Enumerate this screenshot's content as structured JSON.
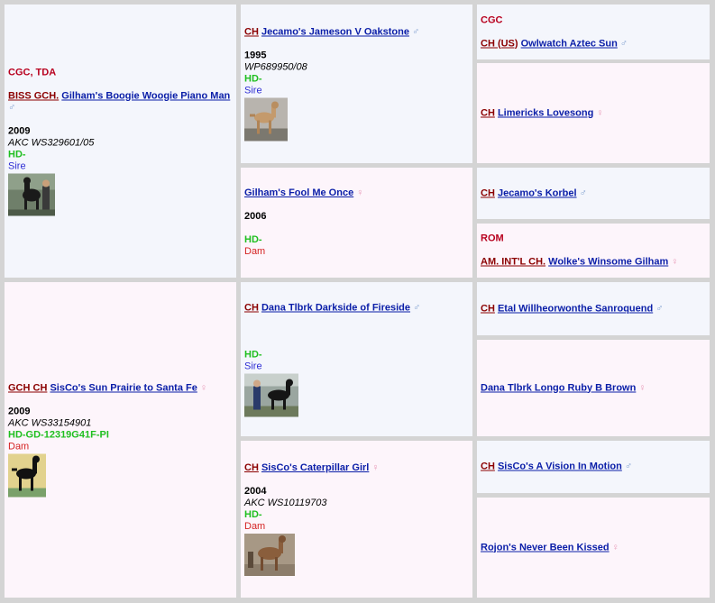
{
  "colors": {
    "border": "#d4d4d4",
    "male_bg": "#f4f6fc",
    "female_bg": "#fdf5fb",
    "titles": "#b8001e",
    "prefix": "#8b0000",
    "name_link": "#0a1ea8",
    "health": "#1fbf1f",
    "sire": "#2d2dd4",
    "dam": "#d42323"
  },
  "symbols": {
    "male": "♂",
    "female": "♀"
  },
  "dogs": [
    {
      "titles_before": "CGC, TDA",
      "prefix": "BISS GCH.",
      "name": "Gilham's Boogie Woogie Piano Man",
      "sex": "male",
      "icon": "male-symbol-icon",
      "year": "2009",
      "registration": "AKC WS329601/05",
      "health": "HD-",
      "role": "Sire",
      "photo": "sire-photo"
    },
    {
      "prefix": "CH",
      "name": "Jecamo's Jameson V Oakstone",
      "sex": "male",
      "icon": "male-symbol-icon",
      "year": "1995",
      "registration": "WP689950/08",
      "health": "HD-",
      "role": "Sire",
      "photo": "sire-photo"
    },
    {
      "titles_before": "CGC",
      "prefix": "CH (US)",
      "name": "Owlwatch Aztec Sun",
      "sex": "male",
      "icon": "male-symbol-icon"
    },
    {
      "prefix": "CH",
      "name": "Limericks Lovesong",
      "sex": "female",
      "icon": "female-symbol-icon"
    },
    {
      "name": "Gilham's Fool Me Once",
      "sex": "female",
      "icon": "female-symbol-icon",
      "year": "2006",
      "health": "HD-",
      "role": "Dam"
    },
    {
      "prefix": "CH",
      "name": "Jecamo's Korbel",
      "sex": "male",
      "icon": "male-symbol-icon"
    },
    {
      "titles_before": "ROM",
      "prefix": "AM. INT'L CH.",
      "name": "Wolke's Winsome Gilham",
      "sex": "female",
      "icon": "female-symbol-icon"
    },
    {
      "prefix": "GCH CH",
      "name": "SisCo's Sun Prairie to Santa Fe",
      "sex": "female",
      "icon": "female-symbol-icon",
      "year": "2009",
      "registration": "AKC WS33154901",
      "health": "HD-GD-12319G41F-PI",
      "role": "Dam",
      "photo": "dam-photo"
    },
    {
      "prefix": "CH",
      "name": "Dana Tlbrk Darkside of Fireside",
      "sex": "male",
      "icon": "male-symbol-icon",
      "health": "HD-",
      "role": "Sire",
      "photo": "sire-photo"
    },
    {
      "prefix": "CH",
      "name": "Etal Willheorwonthe Sanroquend",
      "sex": "male",
      "icon": "male-symbol-icon"
    },
    {
      "name": "Dana Tlbrk Longo Ruby B Brown",
      "sex": "female",
      "icon": "female-symbol-icon"
    },
    {
      "prefix": "CH",
      "name": "SisCo's Caterpillar Girl",
      "sex": "female",
      "icon": "female-symbol-icon",
      "year": "2004",
      "registration": "AKC WS10119703",
      "health": "HD-",
      "role": "Dam",
      "photo": "dam-photo"
    },
    {
      "prefix": "CH",
      "name": "SisCo's A Vision In Motion",
      "sex": "male",
      "icon": "male-symbol-icon"
    },
    {
      "name": "Rojon's Never Been Kissed",
      "sex": "female",
      "icon": "female-symbol-icon"
    }
  ]
}
